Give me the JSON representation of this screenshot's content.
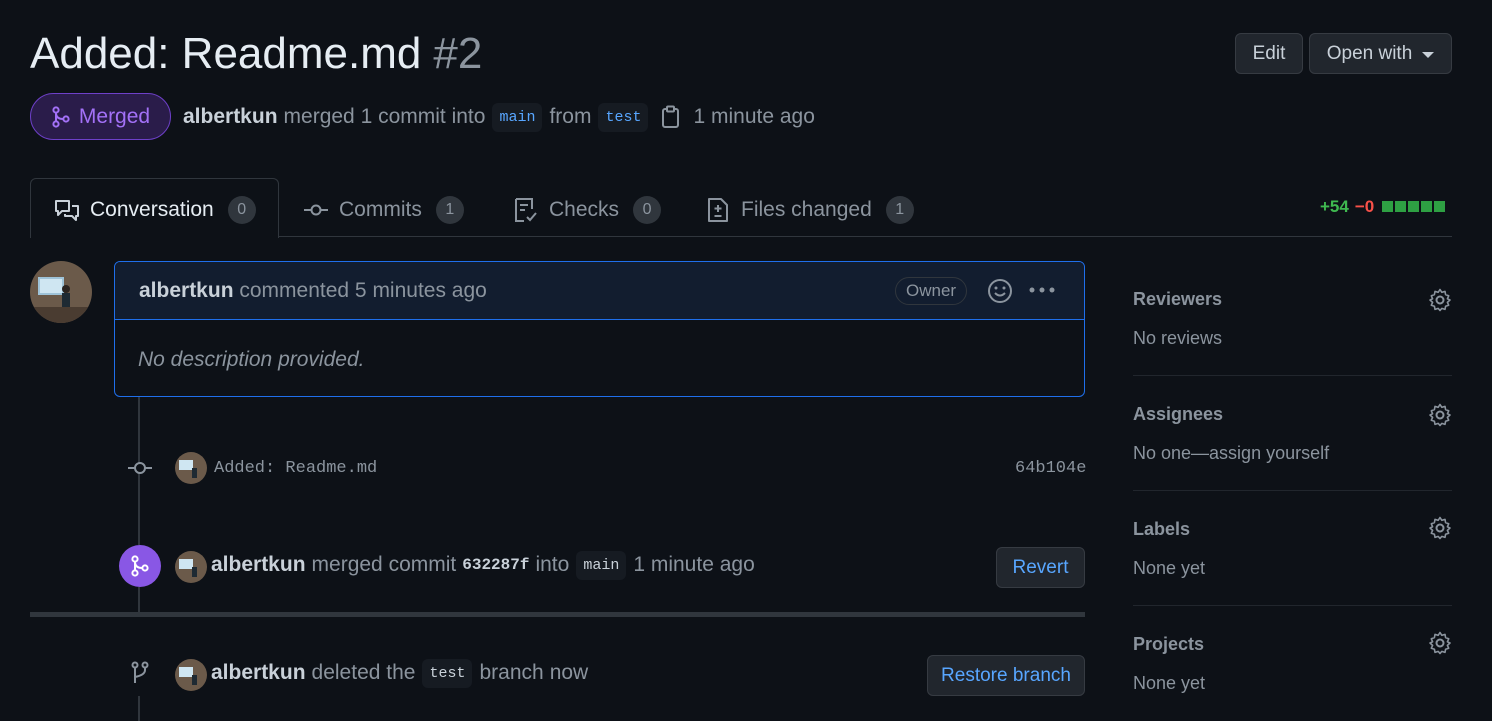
{
  "pr": {
    "title": "Added: Readme.md",
    "number": "#2",
    "status": "Merged",
    "author": "albertkun",
    "merge_text": "merged 1 commit into",
    "base_branch": "main",
    "from_text": "from",
    "head_branch": "test",
    "time": "1 minute ago"
  },
  "header_buttons": {
    "edit": "Edit",
    "open_with": "Open with"
  },
  "tabs": [
    {
      "label": "Conversation",
      "count": "0",
      "icon": "conversation-icon"
    },
    {
      "label": "Commits",
      "count": "1",
      "icon": "commit-icon"
    },
    {
      "label": "Checks",
      "count": "0",
      "icon": "checklist-icon"
    },
    {
      "label": "Files changed",
      "count": "1",
      "icon": "file-diff-icon"
    }
  ],
  "diffstat": {
    "additions": "+54",
    "deletions": "−0"
  },
  "comment": {
    "author": "albertkun",
    "action": "commented 5 minutes ago",
    "badge": "Owner",
    "body": "No description provided."
  },
  "commit": {
    "message": "Added: Readme.md",
    "sha": "64b104e"
  },
  "merge_event": {
    "author": "albertkun",
    "text1": "merged commit",
    "sha": "632287f",
    "text2": "into",
    "branch": "main",
    "time": "1 minute ago",
    "button": "Revert"
  },
  "delete_event": {
    "author": "albertkun",
    "text1": "deleted the",
    "branch": "test",
    "text2": "branch",
    "time": "now",
    "button": "Restore branch"
  },
  "sidebar": {
    "reviewers": {
      "title": "Reviewers",
      "value": "No reviews"
    },
    "assignees": {
      "title": "Assignees",
      "value": "No one—assign yourself"
    },
    "labels": {
      "title": "Labels",
      "value": "None yet"
    },
    "projects": {
      "title": "Projects",
      "value": "None yet"
    }
  },
  "colors": {
    "merged": "#8957e5",
    "link": "#58a6ff",
    "add": "#3fb950",
    "del": "#f85149"
  }
}
